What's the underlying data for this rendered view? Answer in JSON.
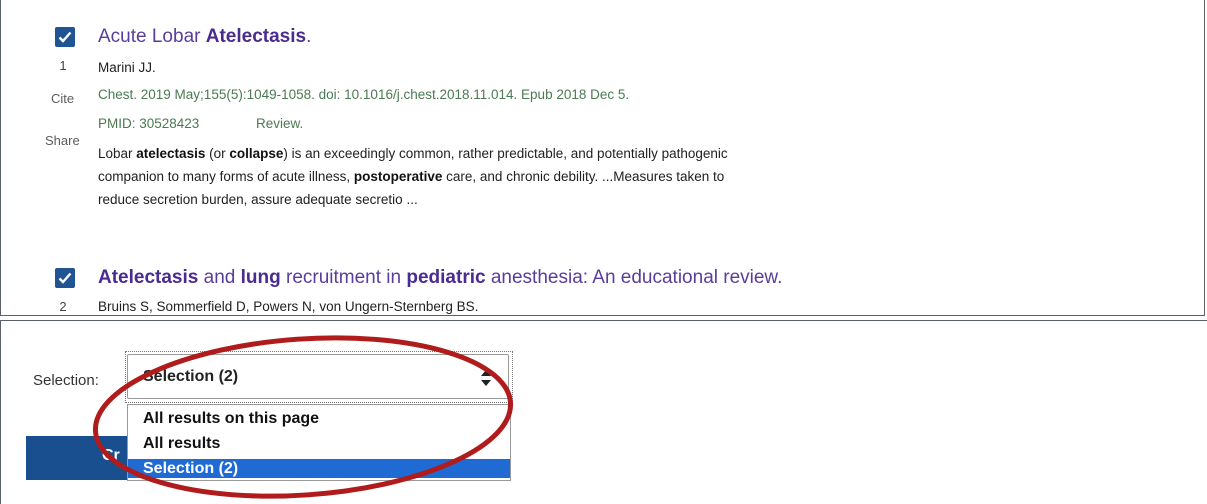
{
  "results": [
    {
      "index": "1",
      "title_parts": [
        {
          "text": "Acute Lobar ",
          "bold": false
        },
        {
          "text": "Atelectasis",
          "bold": true
        },
        {
          "text": ".",
          "bold": false
        }
      ],
      "authors": "Marini JJ.",
      "citation": "Chest. 2019 May;155(5):1049-1058. doi: 10.1016/j.chest.2018.11.014. Epub 2018 Dec 5.",
      "pmid": "PMID: 30528423",
      "pub_type": "Review.",
      "cite_label": "Cite",
      "share_label": "Share",
      "snippet_lines": [
        [
          {
            "text": "Lobar ",
            "bold": false
          },
          {
            "text": "atelectasis",
            "bold": true
          },
          {
            "text": " (or ",
            "bold": false
          },
          {
            "text": "collapse",
            "bold": true
          },
          {
            "text": ") is an exceedingly common, rather predictable, and potentially pathogenic",
            "bold": false
          }
        ],
        [
          {
            "text": "companion to many forms of acute illness, ",
            "bold": false
          },
          {
            "text": "postoperative",
            "bold": true
          },
          {
            "text": " care, and chronic debility. ...Measures taken to",
            "bold": false
          }
        ],
        [
          {
            "text": "reduce secretion burden, assure adequate secretio ...",
            "bold": false
          }
        ]
      ]
    },
    {
      "index": "2",
      "title_parts": [
        {
          "text": "Atelectasis",
          "bold": true
        },
        {
          "text": " and ",
          "bold": false
        },
        {
          "text": "lung",
          "bold": true
        },
        {
          "text": " recruitment in ",
          "bold": false
        },
        {
          "text": "pediatric",
          "bold": true
        },
        {
          "text": " anesthesia: An educational review.",
          "bold": false
        }
      ],
      "authors": "Bruins S, Sommerfield D, Powers N, von Ungern-Sternberg BS."
    }
  ],
  "selection": {
    "label": "Selection:",
    "current": "Selection (2)",
    "options": [
      "All results on this page",
      "All results",
      "Selection (2)"
    ],
    "selected_index": 2
  },
  "create_button": {
    "label": "Cr"
  },
  "colors": {
    "checkbox": "#205493",
    "title": "#5a3d9b",
    "citation": "#4b7a52",
    "highlight": "#1f6bd3",
    "annotation_circle": "#b01c1c"
  },
  "icons": {
    "checkbox": "check-icon",
    "select": "sort-arrows-icon"
  }
}
